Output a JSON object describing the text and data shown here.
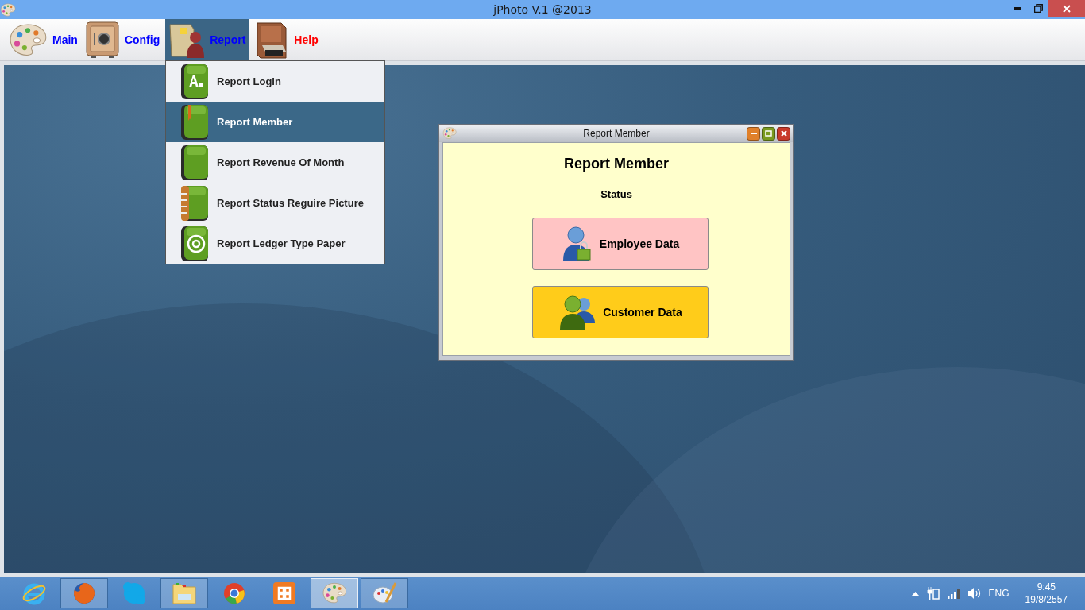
{
  "window": {
    "title": "jPhoto V.1 @2013"
  },
  "menu_bar": [
    {
      "label": "Main",
      "kind": "palette",
      "selected": false,
      "color": "#0000ff"
    },
    {
      "label": "Config",
      "kind": "safe",
      "selected": false,
      "color": "#0000ff"
    },
    {
      "label": "Report",
      "kind": "folder",
      "selected": true,
      "color": "#0000ff"
    },
    {
      "label": "Help",
      "kind": "cabinet",
      "selected": false,
      "color": "#ff0000"
    }
  ],
  "dropdown": [
    {
      "label": "Report Login",
      "kind": "letters",
      "selected": false
    },
    {
      "label": "Report Member",
      "kind": "bookmark",
      "selected": true
    },
    {
      "label": "Report Revenue Of Month",
      "kind": "plain",
      "selected": false
    },
    {
      "label": "Report Status Reguire Picture",
      "kind": "spiral",
      "selected": false
    },
    {
      "label": "Report Ledger Type Paper",
      "kind": "at",
      "selected": false
    }
  ],
  "dialog": {
    "title": "Report Member",
    "heading": "Report Member",
    "subheading": "Status",
    "buttons": [
      {
        "label": "Employee Data",
        "kind": "employee",
        "color": "#ffc4c4"
      },
      {
        "label": "Customer Data",
        "kind": "customers",
        "color": "#ffcc1a"
      }
    ]
  },
  "taskbar": {
    "apps": [
      {
        "kind": "ie",
        "open": false,
        "selected": false
      },
      {
        "kind": "firefox",
        "open": true,
        "selected": false
      },
      {
        "kind": "skype",
        "open": false,
        "selected": false
      },
      {
        "kind": "folder",
        "open": true,
        "selected": false
      },
      {
        "kind": "chrome",
        "open": false,
        "selected": false
      },
      {
        "kind": "xampp",
        "open": false,
        "selected": false
      },
      {
        "kind": "palette",
        "open": true,
        "selected": true
      },
      {
        "kind": "paint",
        "open": true,
        "selected": false
      }
    ],
    "language": "ENG",
    "time": "9:45",
    "date": "19/8/2557"
  }
}
